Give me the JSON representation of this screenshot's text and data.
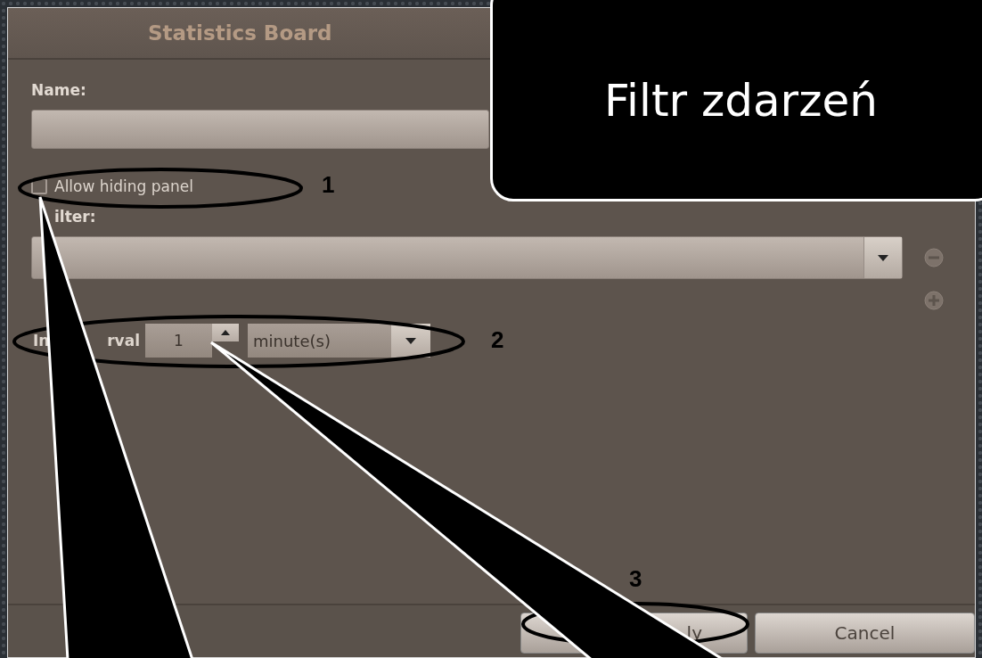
{
  "dialog": {
    "title": "Statistics Board",
    "name_label": "Name:",
    "allow_hiding_panel": {
      "label": "Allow hiding panel",
      "checked": false
    },
    "filter_label": "ilter:",
    "interval": {
      "label_parts": [
        "In",
        "rval"
      ],
      "value": "1",
      "unit": "minute(s)"
    },
    "buttons": [
      {
        "label": "ly"
      },
      {
        "label": "Cancel"
      }
    ]
  },
  "callout": {
    "text": "Filtr zdarzeń"
  },
  "markers": [
    {
      "label": "1"
    },
    {
      "label": "2"
    },
    {
      "label": "3"
    }
  ]
}
